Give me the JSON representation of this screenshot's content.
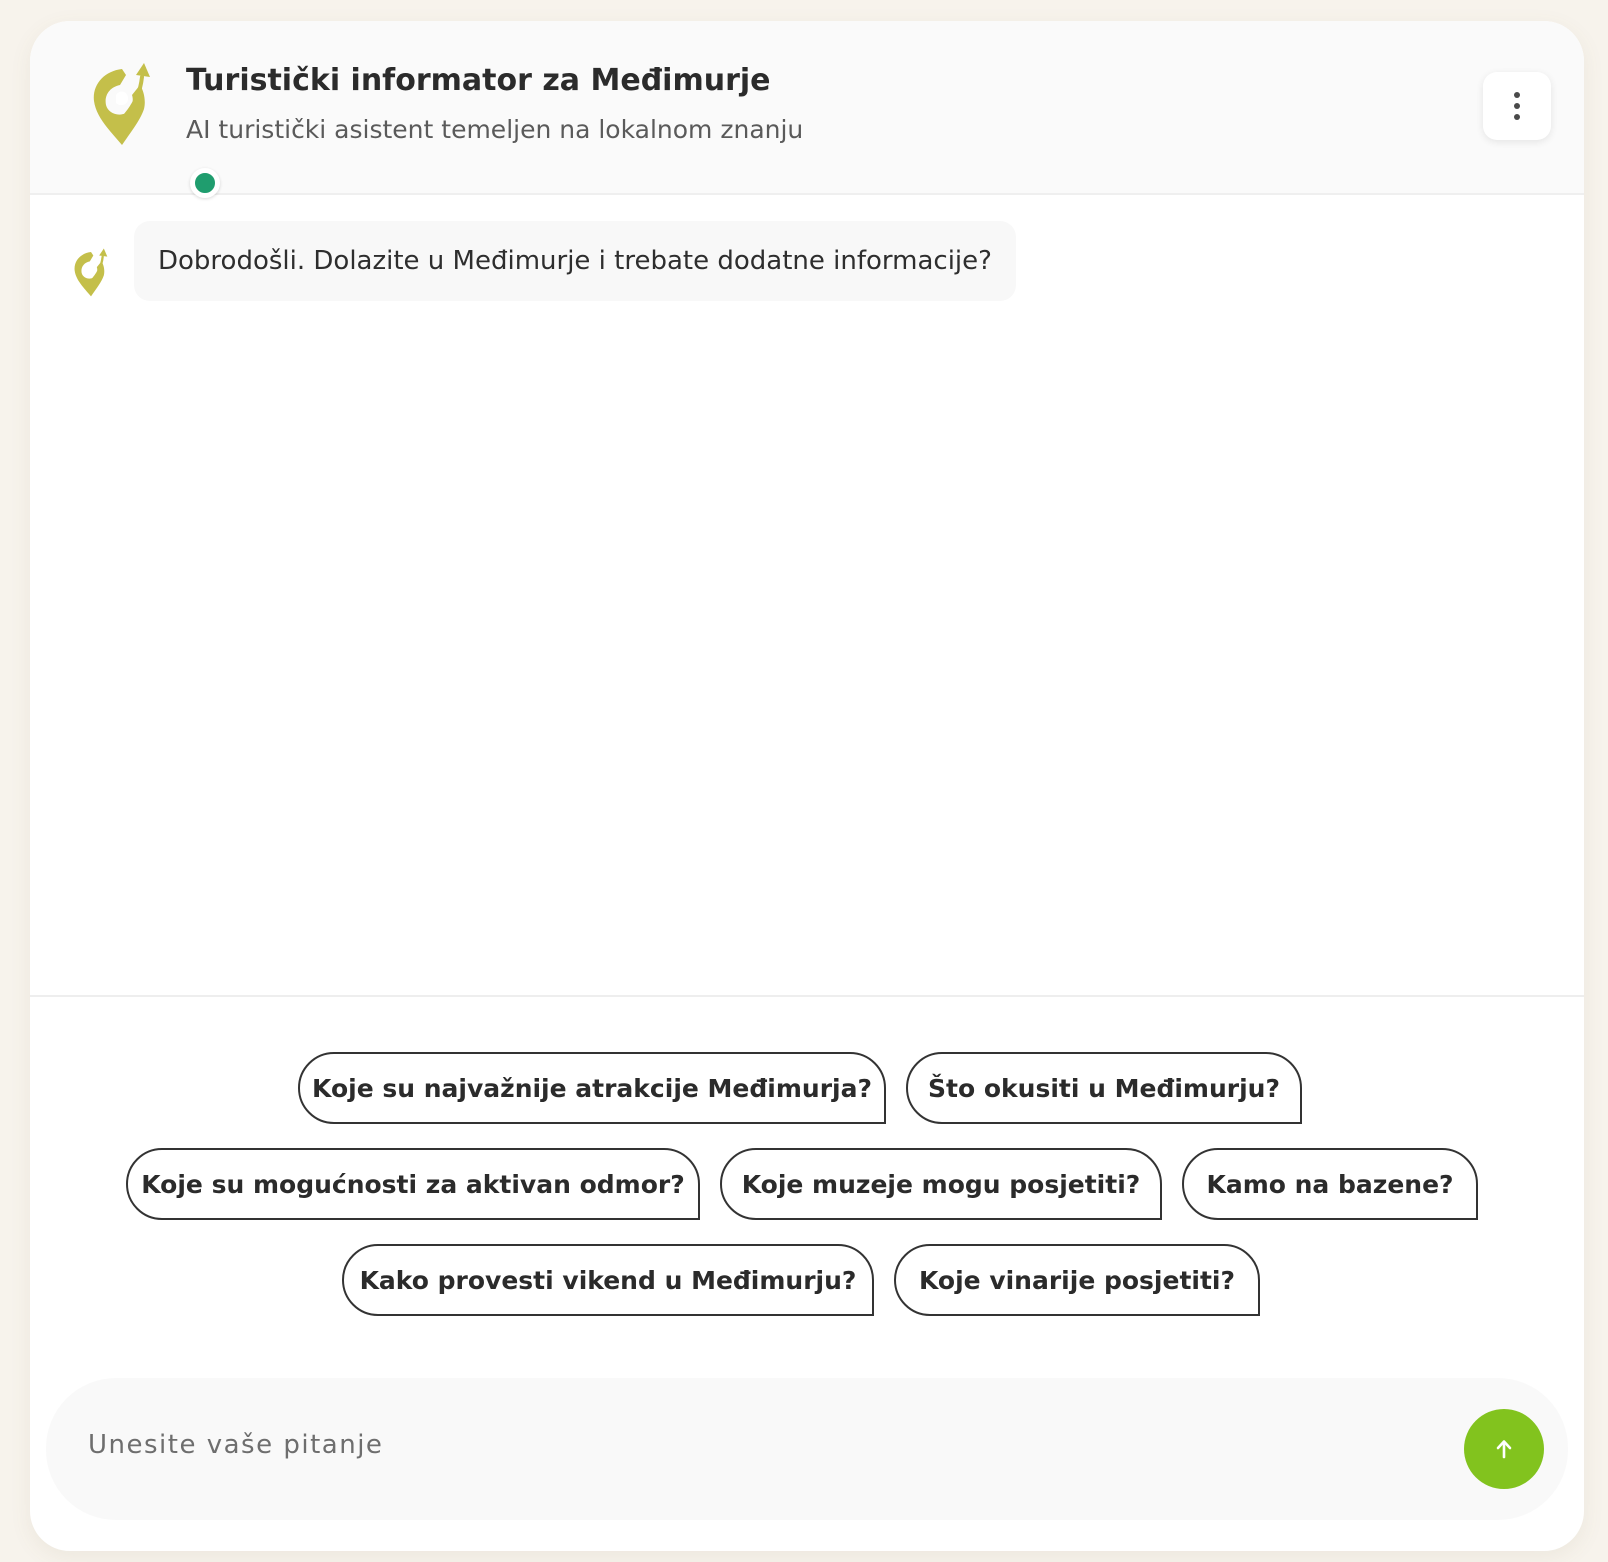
{
  "colors": {
    "page_background": "#f7f3ec",
    "logo_olive": "#c4bf4a",
    "online_status": "#1f9d6e",
    "send_button": "#82c31e"
  },
  "header": {
    "title": "Turistički informator za Međimurje",
    "subtitle": "AI turistički asistent temeljen na lokalnom znanju",
    "logo_icon": "map-pin-arrow-icon",
    "status_icon": "online-dot-icon",
    "menu_icon": "kebab-menu-icon"
  },
  "messages": [
    {
      "sender": "assistant",
      "avatar_icon": "map-pin-arrow-icon",
      "text": "Dobrodošli. Dolazite u Međimurje i trebate dodatne informacije?"
    }
  ],
  "suggestions": [
    "Koje su najvažnije atrakcije Međimurja?",
    "Što okusiti u Međimurju?",
    "Koje su mogućnosti za aktivan odmor?",
    "Koje muzeje mogu posjetiti?",
    "Kamo na bazene?",
    "Kako provesti vikend u Međimurju?",
    "Koje vinarije posjetiti?"
  ],
  "input": {
    "placeholder": "Unesite vaše pitanje",
    "value": "",
    "send_icon": "arrow-up-icon"
  }
}
